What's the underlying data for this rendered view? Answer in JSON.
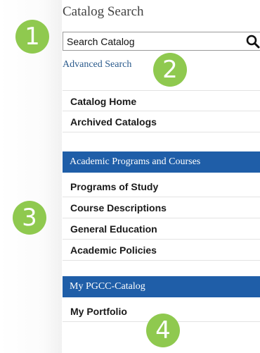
{
  "catalog_search": {
    "title": "Catalog Search",
    "search_placeholder": "Search Catalog",
    "advanced_search_link": "Advanced Search"
  },
  "catalog_nav": {
    "items": [
      {
        "label": "Catalog Home"
      },
      {
        "label": "Archived Catalogs"
      }
    ]
  },
  "academic_section": {
    "header": "Academic Programs and Courses",
    "items": [
      {
        "label": "Programs of Study"
      },
      {
        "label": "Course Descriptions"
      },
      {
        "label": "General Education"
      },
      {
        "label": "Academic Policies"
      }
    ]
  },
  "my_catalog_section": {
    "header": "My PGCC-Catalog",
    "items": [
      {
        "label": "My Portfolio"
      }
    ]
  },
  "callouts": [
    "1",
    "2",
    "3",
    "4"
  ],
  "colors": {
    "header_blue": "#1f5ea8",
    "callout_green": "#8fc94f",
    "link_blue": "#2a5a8c"
  },
  "icons": {
    "search": "search-icon"
  }
}
